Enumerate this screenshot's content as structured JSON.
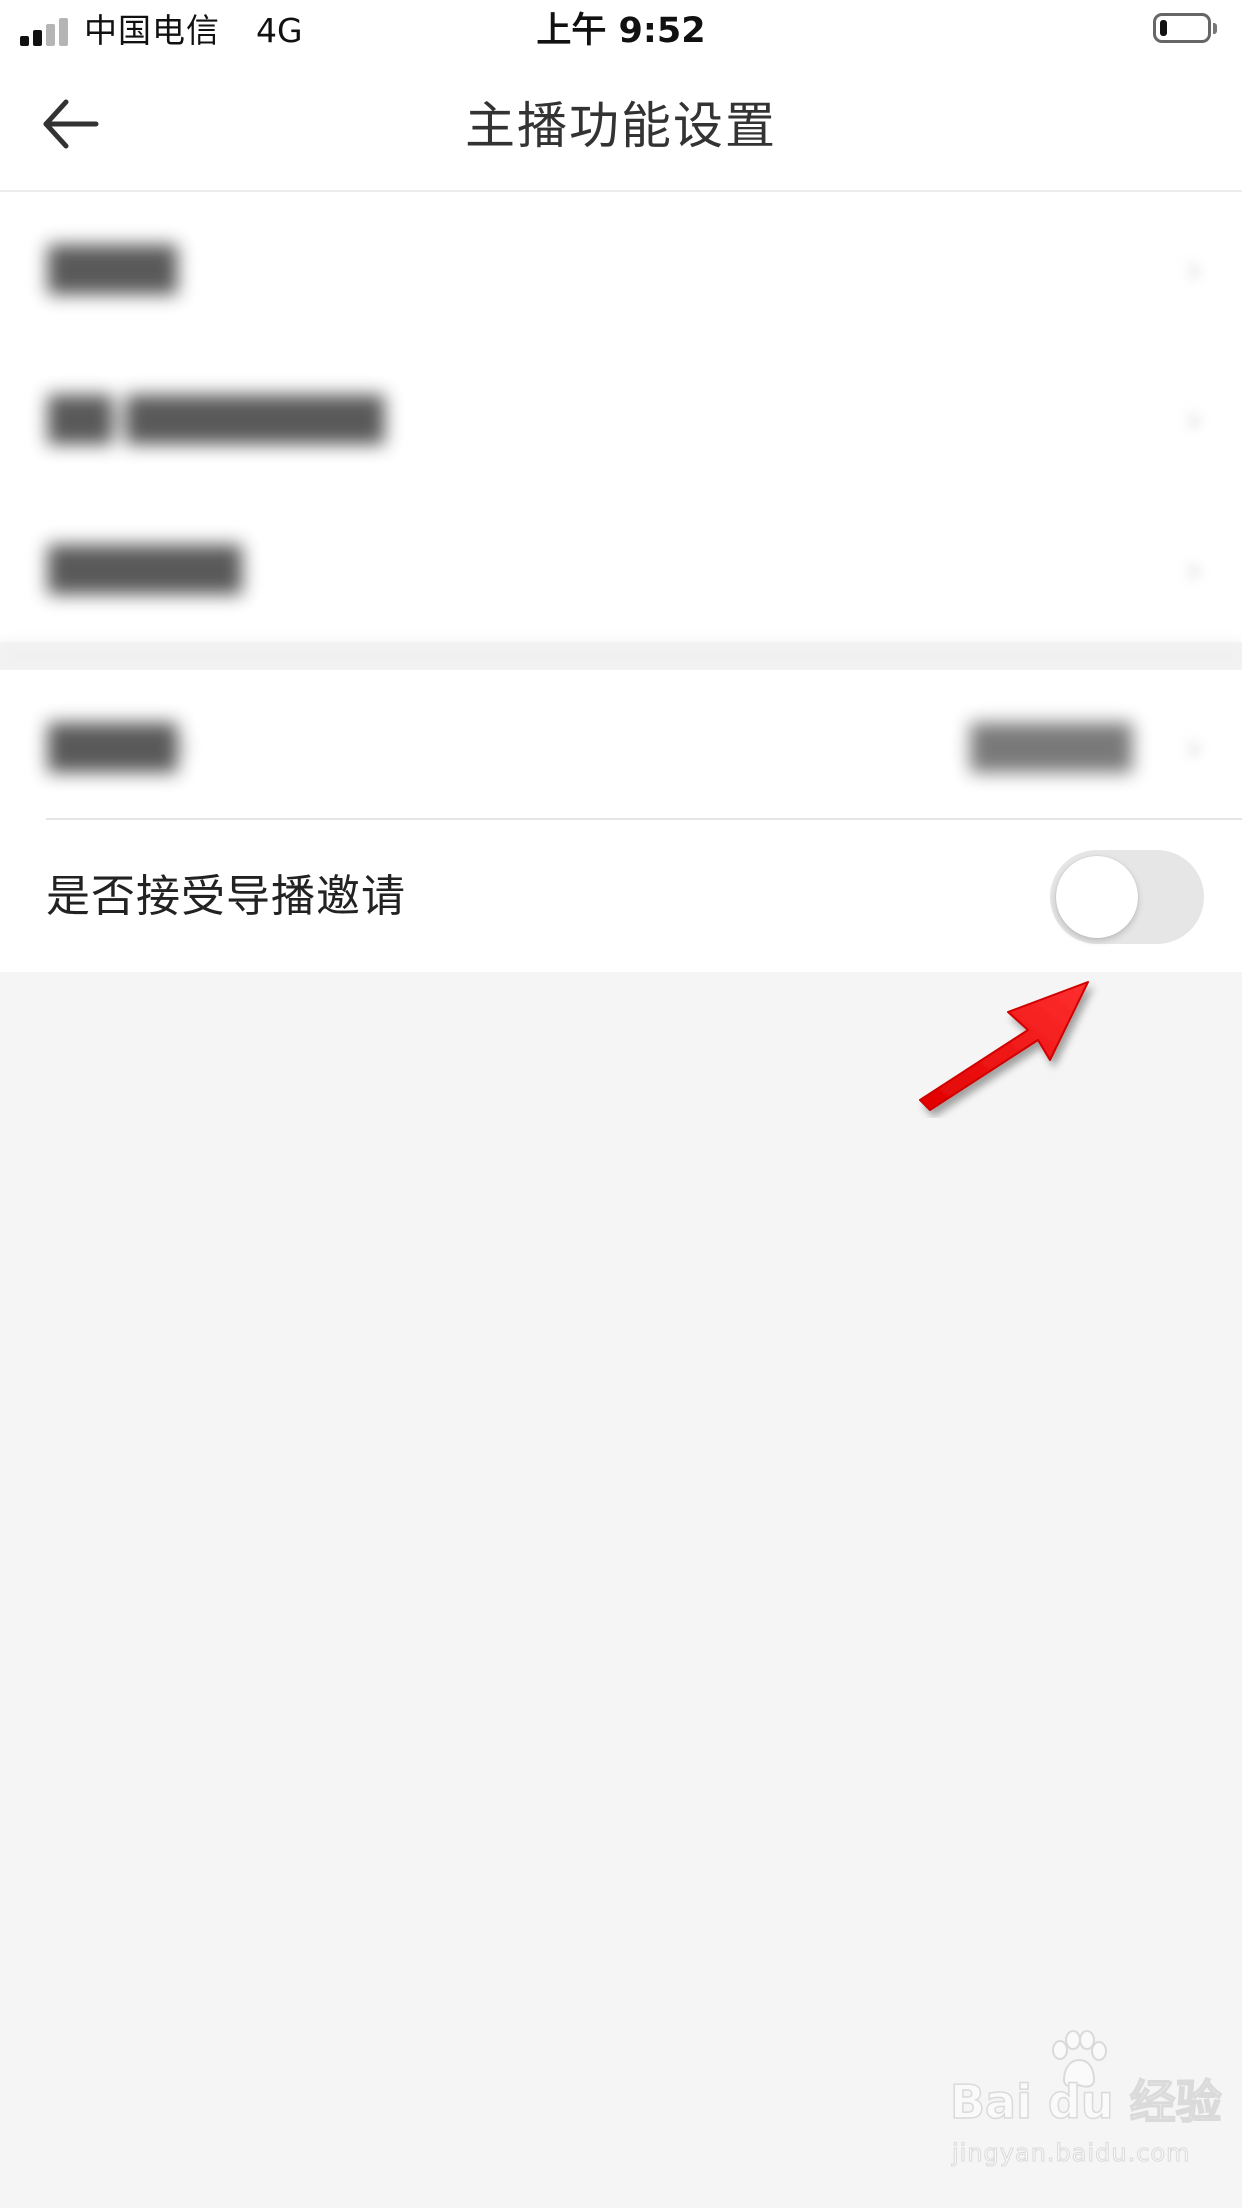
{
  "status_bar": {
    "carrier": "中国电信",
    "network": "4G",
    "time": "上午 9:52",
    "battery_level": 0.15,
    "signal_bars": 2
  },
  "header": {
    "title": "主播功能设置",
    "back_icon": "arrow-left-icon"
  },
  "blurred_settings": {
    "items": [
      {
        "label": "████"
      },
      {
        "label": "██·████████"
      },
      {
        "label": "██████"
      },
      {
        "label": "████·",
        "value": "█████"
      }
    ]
  },
  "invite_setting": {
    "label": "是否接受导播邀请",
    "enabled": false
  },
  "watermark": {
    "brand": "Bai du 经验",
    "url": "jingyan.baidu.com"
  },
  "colors": {
    "background": "#f5f5f5",
    "card": "#ffffff",
    "toggle_off": "#e6e6e6",
    "annotation_arrow": "#ff1a1a"
  }
}
